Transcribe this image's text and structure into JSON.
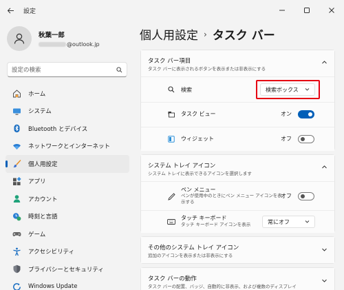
{
  "window": {
    "title": "設定",
    "back_icon": "back-arrow-icon",
    "controls": [
      "minimize-icon",
      "maximize-icon",
      "close-icon"
    ]
  },
  "profile": {
    "name": "秋葉一郎",
    "email_suffix": "@outlook.jp"
  },
  "search": {
    "placeholder": "設定の検索"
  },
  "nav": {
    "items": [
      {
        "label": "ホーム",
        "icon": "home-icon"
      },
      {
        "label": "システム",
        "icon": "system-icon"
      },
      {
        "label": "Bluetooth とデバイス",
        "icon": "bluetooth-icon"
      },
      {
        "label": "ネットワークとインターネット",
        "icon": "wifi-icon"
      },
      {
        "label": "個人用設定",
        "icon": "brush-icon",
        "active": true
      },
      {
        "label": "アプリ",
        "icon": "apps-icon"
      },
      {
        "label": "アカウント",
        "icon": "account-icon"
      },
      {
        "label": "時刻と言語",
        "icon": "clock-globe-icon"
      },
      {
        "label": "ゲーム",
        "icon": "gamepad-icon"
      },
      {
        "label": "アクセシビリティ",
        "icon": "accessibility-icon"
      },
      {
        "label": "プライバシーとセキュリティ",
        "icon": "shield-icon"
      },
      {
        "label": "Windows Update",
        "icon": "update-icon"
      }
    ]
  },
  "breadcrumb": {
    "parent": "個人用設定",
    "separator": "›",
    "current": "タスク バー"
  },
  "sections": {
    "taskbar_items": {
      "title": "タスク バー項目",
      "subtitle": "タスク バーに表示されるボタンを表示または非表示にする",
      "search": {
        "label": "検索",
        "value": "検索ボックス"
      },
      "task_view": {
        "label": "タスク ビュー",
        "state": "オン"
      },
      "widgets": {
        "label": "ウィジェット",
        "state": "オフ"
      }
    },
    "system_tray": {
      "title": "システム トレイ アイコン",
      "subtitle": "システム トレイに表示できるアイコンを選択します",
      "pen_menu": {
        "label": "ペン メニュー",
        "desc": "ペンが使用中のときにペン メニュー アイコンを表示する",
        "state": "オフ"
      },
      "touch_keyboard": {
        "label": "タッチ キーボード",
        "desc": "タッチ キーボード アイコンを表示",
        "value": "常にオフ"
      }
    },
    "other_tray": {
      "title": "その他のシステム トレイ アイコン",
      "subtitle": "追加のアイコンを表示または非表示にする"
    },
    "behavior": {
      "title": "タスク バーの動作",
      "subtitle": "タスク バーの配置、バッジ、自動的に非表示、および複数のディスプレイ"
    }
  },
  "colors": {
    "accent": "#005fb8",
    "highlight": "#e60012"
  }
}
